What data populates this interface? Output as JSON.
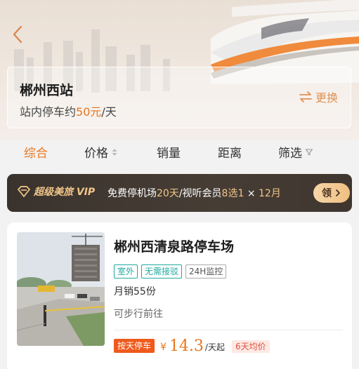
{
  "station": {
    "name": "郴州西站",
    "desc_prefix": "站内停车约",
    "desc_price": "50元",
    "desc_suffix": "/天",
    "switch_label": "更换"
  },
  "sort_tabs": [
    {
      "label": "综合",
      "active": true
    },
    {
      "label": "价格",
      "icon": "sort-arrows-icon"
    },
    {
      "label": "销量"
    },
    {
      "label": "距离"
    },
    {
      "label": "筛选",
      "icon": "filter-icon"
    }
  ],
  "vip": {
    "logo_text": "超级美旅 VIP",
    "promo_part1": "免费停机场",
    "promo_highlight1": "20天",
    "promo_part2": "/视听会员",
    "promo_highlight2": "8选1",
    "promo_part3": " × ",
    "promo_highlight3": "12月",
    "button_label": "领"
  },
  "lot": {
    "title": "郴州西清泉路停车场",
    "tags": [
      "室外",
      "无需接驳",
      "24H监控"
    ],
    "sales": "月销55份",
    "walk": "可步行前往",
    "badge": "按天停车",
    "currency": "¥",
    "price": "14.3",
    "price_unit": "/天起",
    "avg_badge": "6天均价"
  },
  "colors": {
    "accent": "#e8761f",
    "vip_bg": "#3a332d",
    "vip_gold": "#f1c58a",
    "tag_teal": "#20a9a0",
    "badge_red": "#ef5a1c"
  }
}
